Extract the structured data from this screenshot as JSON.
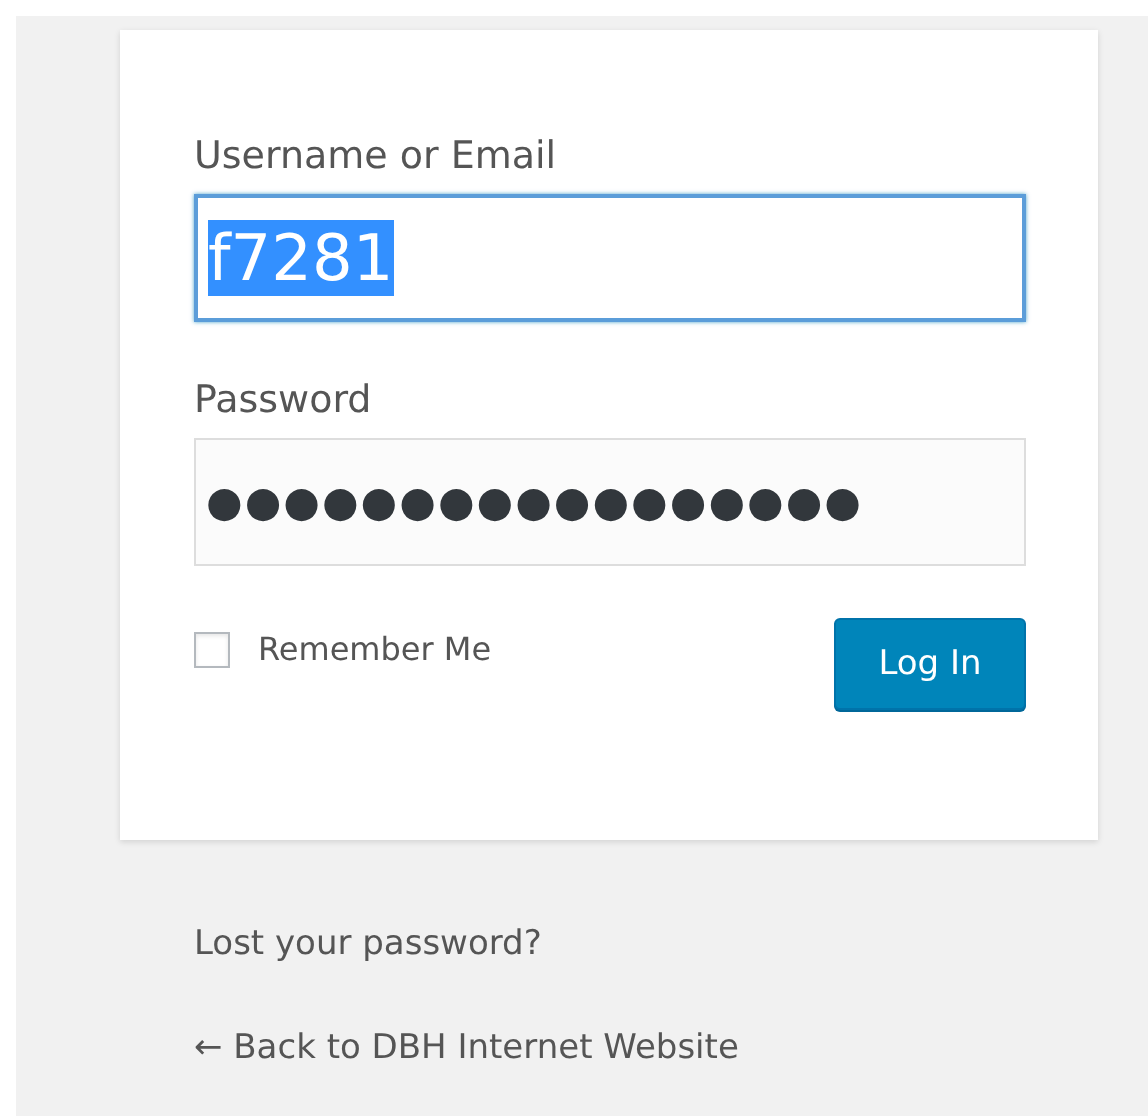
{
  "login_form": {
    "username": {
      "label": "Username or Email",
      "value": "f7281",
      "selected": true,
      "focused": true
    },
    "password": {
      "label": "Password",
      "value": "●●●●●●●●●●●●●●●●●"
    },
    "remember_me": {
      "label": "Remember Me",
      "checked": false
    },
    "submit": "Log In"
  },
  "links": [
    "Lost your password?",
    "← Back to DBH Internet Website"
  ]
}
